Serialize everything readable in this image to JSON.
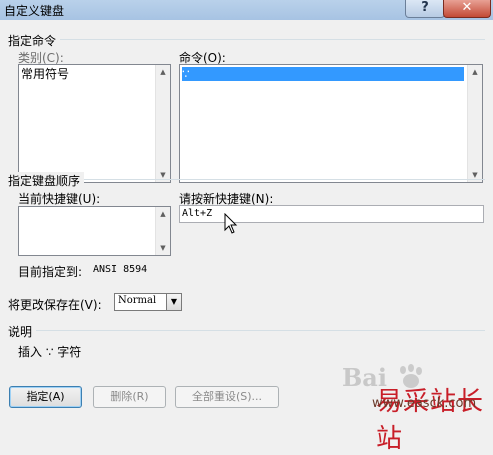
{
  "window": {
    "title": "自定义键盘",
    "help_label": "?",
    "close_label": "✕"
  },
  "assign_command": {
    "section_label": "指定命令",
    "categories_label": "类别(C):",
    "categories": [
      "常用符号"
    ],
    "commands_label": "命令(O):",
    "commands": [
      " ∵"
    ],
    "selected_command_index": 0
  },
  "keyboard_sequence": {
    "section_label": "指定键盘顺序",
    "current_keys_label": "当前快捷键(U):",
    "current_keys": [],
    "new_key_label": "请按新快捷键(N):",
    "new_key_value": "Alt+Z",
    "assigned_to_label": "目前指定到:",
    "assigned_to_value": "ANSI 8594"
  },
  "save_changes": {
    "label": "将更改保存在(V):",
    "value": "Normal"
  },
  "description": {
    "section_label": "说明",
    "text": "插入 ∵ 字符"
  },
  "buttons": {
    "assign": "指定(A)",
    "remove": "删除(R)",
    "reset_all": "全部重设(S)..."
  },
  "watermark": {
    "baidu": "Bai",
    "site_name": "易采站长站",
    "site_url": "www.easck.com"
  }
}
